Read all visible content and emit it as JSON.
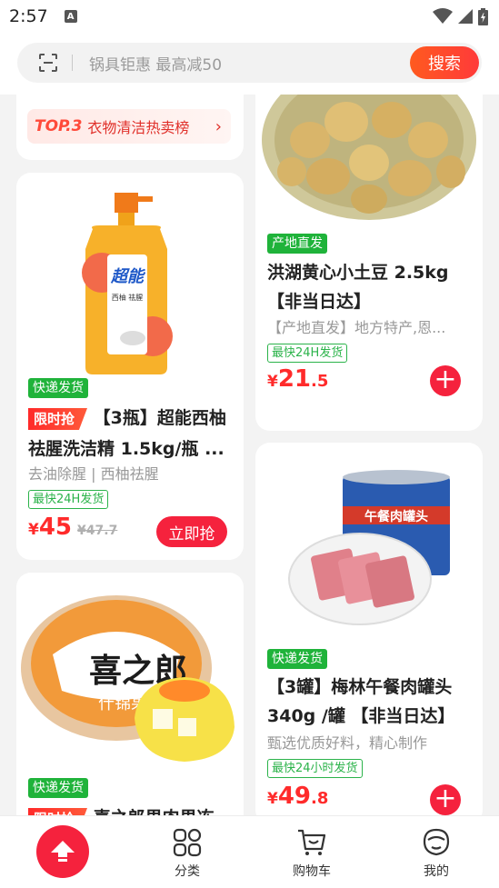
{
  "status_bar": {
    "time": "2:57",
    "notification_glyph": "A"
  },
  "search": {
    "placeholder": "锅具钜惠 最高减50",
    "button_label": "搜索"
  },
  "ranking_banner": {
    "badge": "TOP.3",
    "label": "衣物清洁热卖榜"
  },
  "products": [
    {
      "tag": "快递发货",
      "flash_tag": "限时抢",
      "title_line1": "【3瓶】超能西柚",
      "title_line2": "祛腥洗洁精 1.5kg/瓶 ...",
      "subtitle": "去油除腥 | 西柚祛腥",
      "shipping": "最快24H发货",
      "price_yen": "¥",
      "price_int": "45",
      "orig_price": "¥47.7",
      "cta_label": "立即抢",
      "package_brand": "超能",
      "package_text": "西柚 祛腥"
    },
    {
      "tag": "产地直发",
      "title_line1": "洪湖黄心小土豆 2.5kg",
      "title_line2": "【非当日达】",
      "subtitle": "【产地直发】地方特产,恩...",
      "shipping": "最快24H发货",
      "price_yen": "¥",
      "price_int": "21",
      "price_dec": ".5"
    },
    {
      "tag": "快递发货",
      "flash_tag": "限时抢",
      "title_partial": "喜之郎果肉果冻",
      "package_brand": "喜之郎",
      "package_text": "什锦果肉"
    },
    {
      "tag": "快递发货",
      "title_line1": "【3罐】梅林午餐肉罐头",
      "title_line2": "340g /罐 【非当日达】",
      "subtitle": "甄选优质好料，精心制作",
      "shipping": "最快24小时发货",
      "price_yen": "¥",
      "price_int": "49",
      "price_dec": ".8",
      "package_text": "午餐肉罐头"
    }
  ],
  "bottom_nav": {
    "items": [
      {
        "label": "分类"
      },
      {
        "label": "购物车"
      },
      {
        "label": "我的"
      }
    ]
  },
  "colors": {
    "accent": "#f5223d",
    "green": "#1fb33a",
    "price": "#ff2b2b"
  }
}
